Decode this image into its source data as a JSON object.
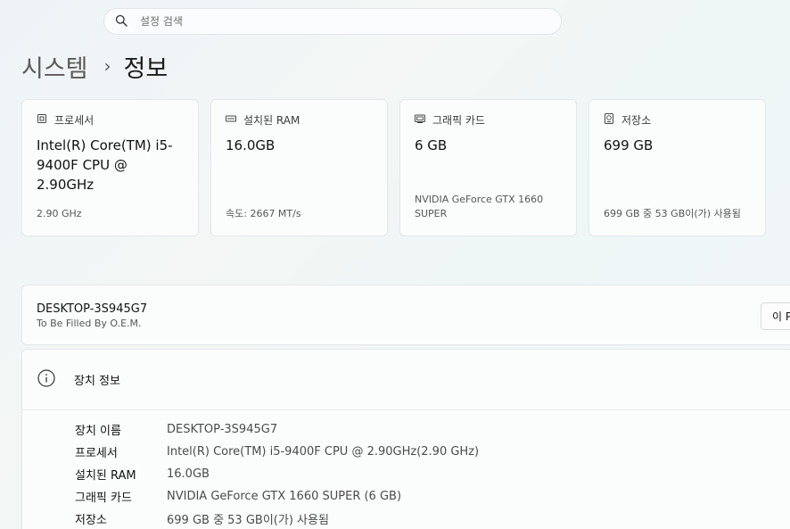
{
  "search": {
    "placeholder": "설정 검색"
  },
  "breadcrumb": {
    "parent": "시스템",
    "separator": "›",
    "current": "정보"
  },
  "cards": [
    {
      "icon": "processor-icon",
      "title": "프로세서",
      "value": "Intel(R) Core(TM) i5-9400F CPU @ 2.90GHz",
      "sub": "2.90 GHz"
    },
    {
      "icon": "memory-icon",
      "title": "설치된 RAM",
      "value": "16.0GB",
      "sub": "속도: 2667 MT/s"
    },
    {
      "icon": "graphics-card-icon",
      "title": "그래픽 카드",
      "value": "6 GB",
      "sub": "NVIDIA GeForce GTX 1660 SUPER"
    },
    {
      "icon": "storage-icon",
      "title": "저장소",
      "value": "699 GB",
      "sub": "699 GB 중 53 GB이(가) 사용됨"
    }
  ],
  "device": {
    "name": "DESKTOP-3S945G7",
    "oem": "To Be Filled By O.E.M.",
    "rename_label": "이 P"
  },
  "specs": {
    "title": "장치 정보",
    "rows": [
      {
        "label": "장치 이름",
        "value": "DESKTOP-3S945G7"
      },
      {
        "label": "프로세서",
        "value": "Intel(R) Core(TM) i5-9400F CPU @ 2.90GHz(2.90 GHz)"
      },
      {
        "label": "설치된 RAM",
        "value": "16.0GB"
      },
      {
        "label": "그래픽 카드",
        "value": "NVIDIA GeForce GTX 1660 SUPER (6 GB)"
      },
      {
        "label": "저장소",
        "value": "699 GB 중 53 GB이(가) 사용됨"
      }
    ]
  }
}
